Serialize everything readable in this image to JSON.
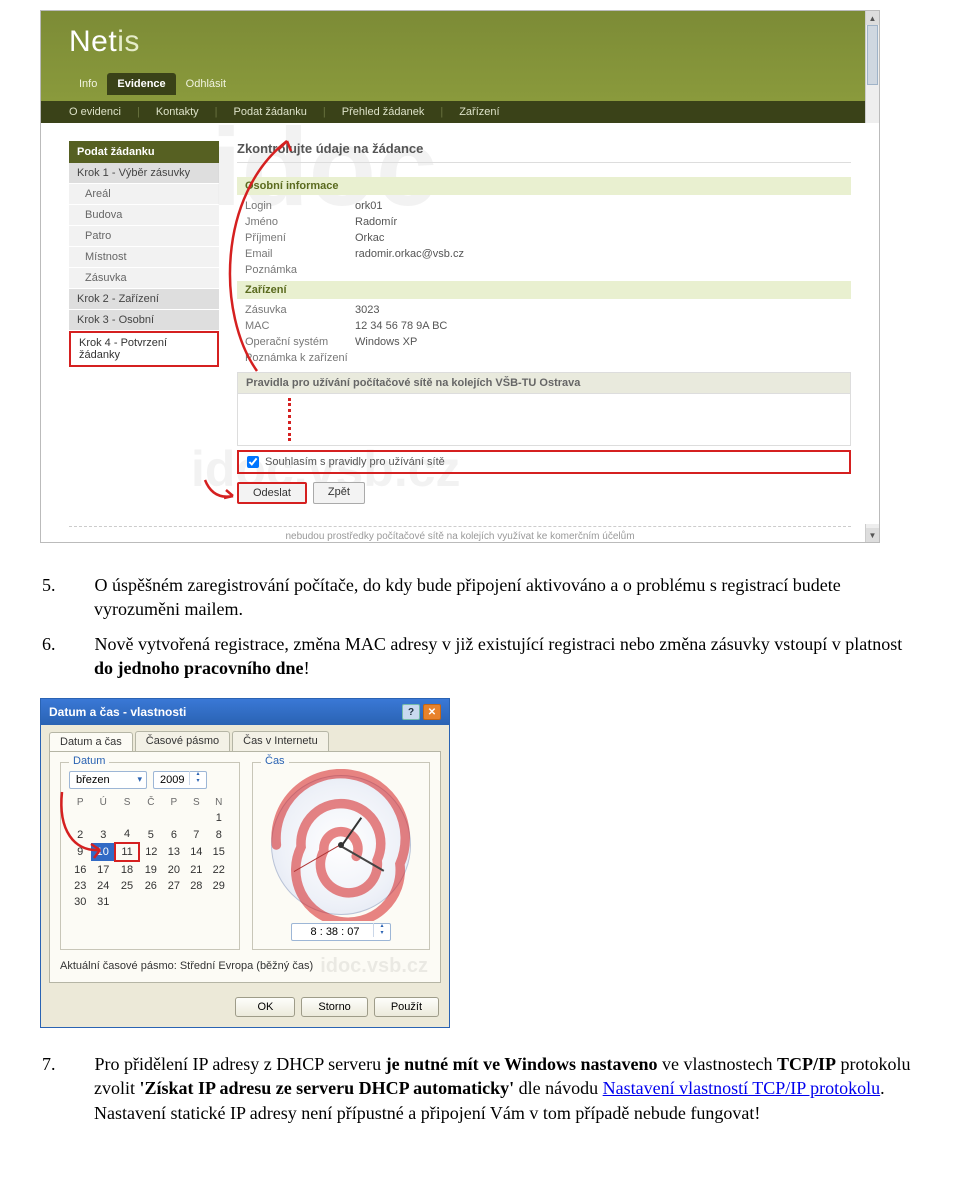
{
  "netis": {
    "logoMain": "Net",
    "logoSub": "is",
    "tabs": {
      "info": "Info",
      "evidence": "Evidence",
      "logout": "Odhlásit"
    },
    "subnav": {
      "about": "O evidenci",
      "contacts": "Kontakty",
      "submit": "Podat žádanku",
      "list": "Přehled žádanek",
      "devices": "Zařízení"
    },
    "sidebar": {
      "title": "Podat žádanku",
      "steps": {
        "k1": "Krok 1 - Výběr zásuvky",
        "areal": "Areál",
        "budova": "Budova",
        "patro": "Patro",
        "mistnost": "Místnost",
        "zasuvka": "Zásuvka",
        "k2": "Krok 2 - Zařízení",
        "k3": "Krok 3 - Osobní",
        "k4": "Krok 4 - Potvrzení žádanky"
      }
    },
    "form": {
      "heading": "Zkontrolujte údaje na žádance",
      "grpPersonal": "Osobní informace",
      "login": {
        "label": "Login",
        "value": "ork01"
      },
      "jmeno": {
        "label": "Jméno",
        "value": "Radomír"
      },
      "prijmeni": {
        "label": "Příjmení",
        "value": "Orkac"
      },
      "email": {
        "label": "Email",
        "value": "radomir.orkac@vsb.cz"
      },
      "poznamka": {
        "label": "Poznámka",
        "value": ""
      },
      "grpDevice": "Zařízení",
      "zasuvka": {
        "label": "Zásuvka",
        "value": "3023"
      },
      "mac": {
        "label": "MAC",
        "value": "12 34 56 78 9A BC"
      },
      "os": {
        "label": "Operační systém",
        "value": "Windows XP"
      },
      "pozZar": {
        "label": "Poznámka k zařízení",
        "value": ""
      },
      "rulesTitle": "Pravidla pro užívání počítačové sítě na kolejích VŠB-TU Ostrava",
      "agree": "Souhlasím s pravidly pro užívání sítě",
      "send": "Odeslat",
      "back": "Zpět",
      "footerCrop": "nebudou prostředky počítačové sítě na kolejích využívat ke komerčním účelům"
    },
    "watermark1": "idoc",
    "watermark2": "idoc.vsb.cz"
  },
  "doc": {
    "item5": {
      "num": "5.",
      "text": "O úspěšném zaregistrování počítače, do kdy bude připojení aktivováno a o problému s registrací budete vyrozuměni mailem."
    },
    "item6": {
      "num": "6.",
      "text_a": "Nově vytvořená registrace, změna MAC adresy v již existující registraci nebo změna zásuvky vstoupí v platnost ",
      "bold": "do jednoho pracovního dne",
      "text_b": "!"
    },
    "item7": {
      "num": "7.",
      "text_a": "Pro přidělení IP adresy z DHCP serveru ",
      "bold1": "je nutné mít ve Windows nastaveno",
      "text_b": " ve vlastnostech ",
      "bold2": "TCP/IP",
      "text_c": " protokolu zvolit ",
      "bold3": "'Získat IP adresu ze serveru DHCP automaticky'",
      "text_d": " dle návodu ",
      "link": "Nastavení vlastností TCP/IP protokolu",
      "period": ".",
      "warn": "Nastavení statické IP adresy není přípustné a připojení Vám v tom případě nebude fungovat!"
    }
  },
  "dlg": {
    "title": "Datum a čas - vlastnosti",
    "tabs": {
      "dt": "Datum a čas",
      "tz": "Časové pásmo",
      "inet": "Čas v Internetu"
    },
    "dateLegend": "Datum",
    "timeLegend": "Čas",
    "month": "březen",
    "year": "2009",
    "dow": {
      "po": "P",
      "ut": "Ú",
      "st": "S",
      "ct": "Č",
      "pa": "P",
      "so": "S",
      "ne": "N"
    },
    "time": "8 : 38 : 07",
    "tzLabel": "Aktuální časové pásmo: ",
    "tzValue": "Střední Evropa (běžný čas)",
    "ok": "OK",
    "cancel": "Storno",
    "apply": "Použít",
    "wm": "idoc.vsb.cz",
    "cal": {
      "w1": [
        "",
        "",
        "",
        "",
        "",
        "",
        "1"
      ],
      "w2": [
        "2",
        "3",
        "4",
        "5",
        "6",
        "7",
        "8"
      ],
      "w3": [
        "9",
        "10",
        "11",
        "12",
        "13",
        "14",
        "15"
      ],
      "w4": [
        "16",
        "17",
        "18",
        "19",
        "20",
        "21",
        "22"
      ],
      "w5": [
        "23",
        "24",
        "25",
        "26",
        "27",
        "28",
        "29"
      ],
      "w6": [
        "30",
        "31",
        "",
        "",
        "",
        "",
        ""
      ]
    }
  }
}
